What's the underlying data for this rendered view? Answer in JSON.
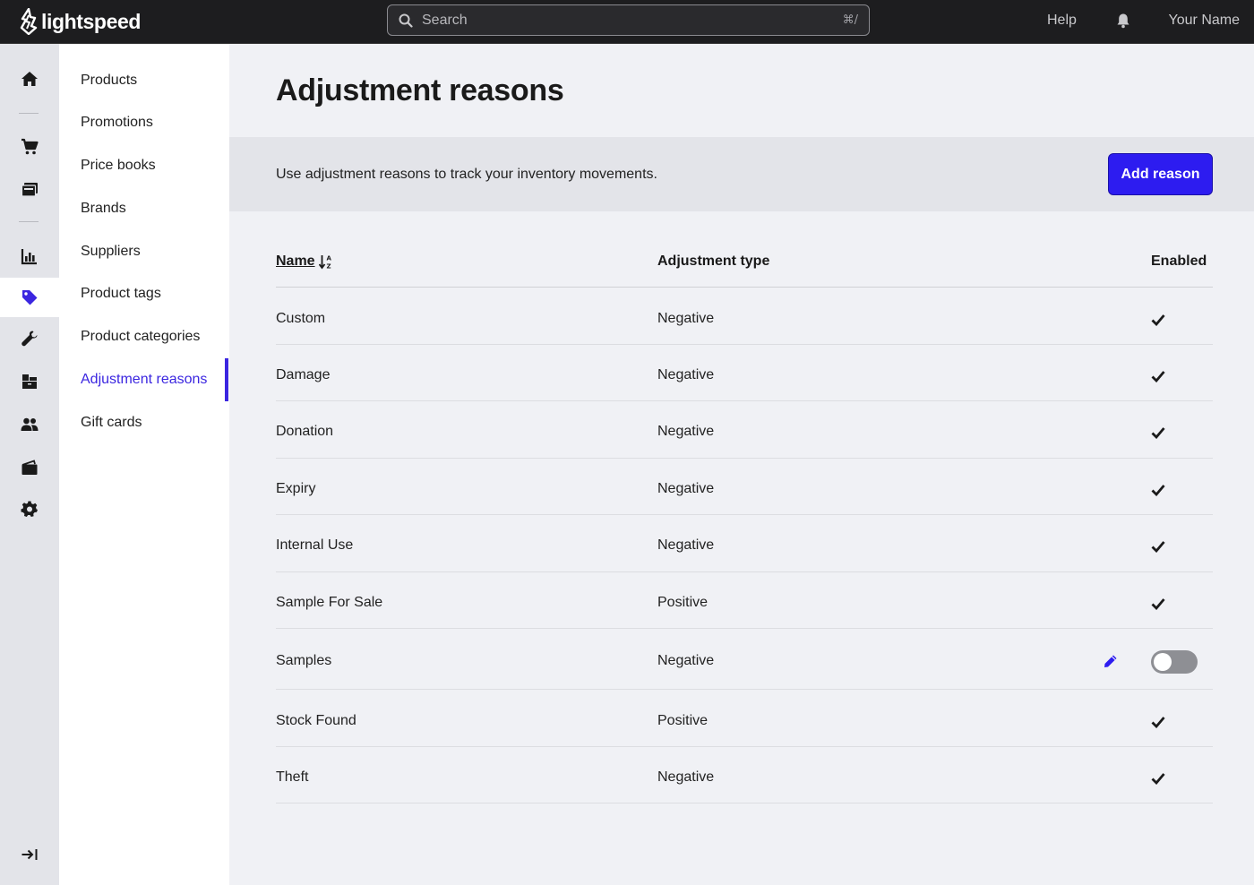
{
  "brand": {
    "name": "lightspeed"
  },
  "topbar": {
    "search_placeholder": "Search",
    "search_shortcut": "⌘/",
    "help": "Help",
    "user": "Your Name"
  },
  "rail": {
    "icons": [
      "home-icon",
      "cart-icon",
      "register-icon",
      "reports-icon",
      "tag-icon",
      "wrench-icon",
      "inventory-icon",
      "customers-icon",
      "wallet-icon",
      "settings-icon",
      "expand-icon"
    ],
    "active": "tag-icon"
  },
  "subnav": {
    "items": [
      {
        "label": "Products"
      },
      {
        "label": "Promotions"
      },
      {
        "label": "Price books"
      },
      {
        "label": "Brands"
      },
      {
        "label": "Suppliers"
      },
      {
        "label": "Product tags"
      },
      {
        "label": "Product categories"
      },
      {
        "label": "Adjustment reasons"
      },
      {
        "label": "Gift cards"
      }
    ],
    "active": "Adjustment reasons"
  },
  "page": {
    "title": "Adjustment reasons",
    "banner_text": "Use adjustment reasons to track your inventory movements.",
    "add_button": "Add reason"
  },
  "table": {
    "headers": {
      "name": "Name",
      "type": "Adjustment type",
      "enabled": "Enabled"
    },
    "rows": [
      {
        "name": "Custom",
        "type": "Negative",
        "enabled": true
      },
      {
        "name": "Damage",
        "type": "Negative",
        "enabled": true
      },
      {
        "name": "Donation",
        "type": "Negative",
        "enabled": true
      },
      {
        "name": "Expiry",
        "type": "Negative",
        "enabled": true
      },
      {
        "name": "Internal Use",
        "type": "Negative",
        "enabled": true
      },
      {
        "name": "Sample For Sale",
        "type": "Positive",
        "enabled": true
      },
      {
        "name": "Samples",
        "type": "Negative",
        "enabled": false,
        "editable": true
      },
      {
        "name": "Stock Found",
        "type": "Positive",
        "enabled": true
      },
      {
        "name": "Theft",
        "type": "Negative",
        "enabled": true
      }
    ]
  },
  "colors": {
    "accent": "#2d1cf0",
    "topbar": "#1d1d1f",
    "rail": "#e3e4e9",
    "page_bg": "#f0f1f5"
  }
}
